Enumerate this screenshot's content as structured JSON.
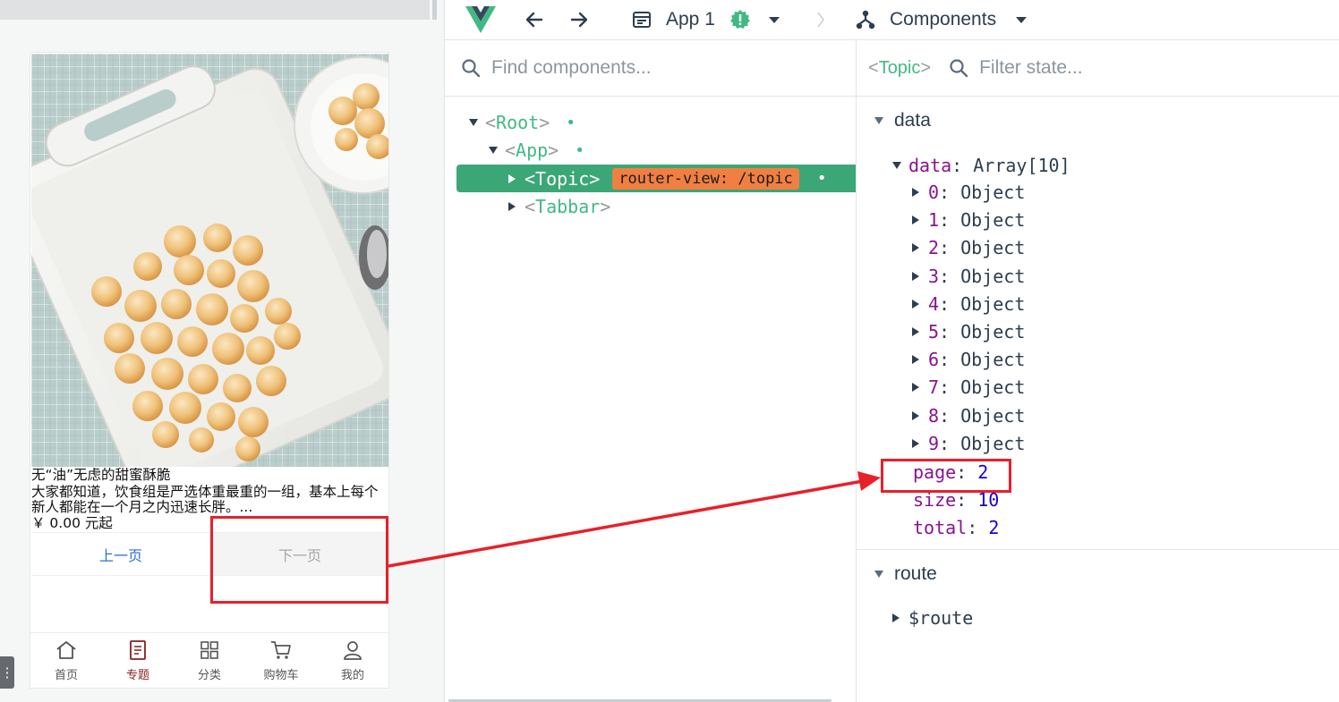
{
  "preview": {
    "article": {
      "title": "无“油”无虑的甜蜜酥脆",
      "description": "大家都知道，饮食组是严选体重最重的一组，基本上每个新人都能在一个月之内迅速长胖。...",
      "price": "￥ 0.00 元起"
    },
    "pager": {
      "prev_label": "上一页",
      "next_label": "下一页"
    },
    "tabbar": [
      {
        "label": "首页",
        "icon": "home-icon"
      },
      {
        "label": "专题",
        "icon": "topic-icon",
        "active": true
      },
      {
        "label": "分类",
        "icon": "category-icon"
      },
      {
        "label": "购物车",
        "icon": "cart-icon"
      },
      {
        "label": "我的",
        "icon": "user-icon"
      }
    ],
    "handle_glyph": "⋮"
  },
  "devtools": {
    "app_name": "App 1",
    "section": "Components",
    "colors": {
      "vue_green": "#42b983",
      "highlight": "#3ba776",
      "badge": "#f17f42",
      "annotation": "#e8202a"
    },
    "search": {
      "placeholder": "Find components..."
    },
    "tree": {
      "root": {
        "lt": "<",
        "name": "Root",
        "gt": ">"
      },
      "app": {
        "lt": "<",
        "name": "App",
        "gt": ">"
      },
      "topic": {
        "lt": "<",
        "name": "Topic",
        "gt": ">",
        "badge": "router-view: /topic"
      },
      "tabbar": {
        "lt": "<",
        "name": "Tabbar",
        "gt": ">"
      },
      "dot": "•"
    },
    "inspector": {
      "selected": {
        "lt": "<",
        "name": "Topic",
        "gt": ">"
      },
      "filter_placeholder": "Filter state...",
      "data_section": "data",
      "data_key": "data",
      "data_type": "Array[10]",
      "items": [
        {
          "index": "0",
          "type": "Object"
        },
        {
          "index": "1",
          "type": "Object"
        },
        {
          "index": "2",
          "type": "Object"
        },
        {
          "index": "3",
          "type": "Object"
        },
        {
          "index": "4",
          "type": "Object"
        },
        {
          "index": "5",
          "type": "Object"
        },
        {
          "index": "6",
          "type": "Object"
        },
        {
          "index": "7",
          "type": "Object"
        },
        {
          "index": "8",
          "type": "Object"
        },
        {
          "index": "9",
          "type": "Object"
        }
      ],
      "page": {
        "key": "page",
        "value": "2"
      },
      "size": {
        "key": "size",
        "value": "10"
      },
      "total": {
        "key": "total",
        "value": "2"
      },
      "route_section": "route",
      "route_key": "$route"
    }
  }
}
